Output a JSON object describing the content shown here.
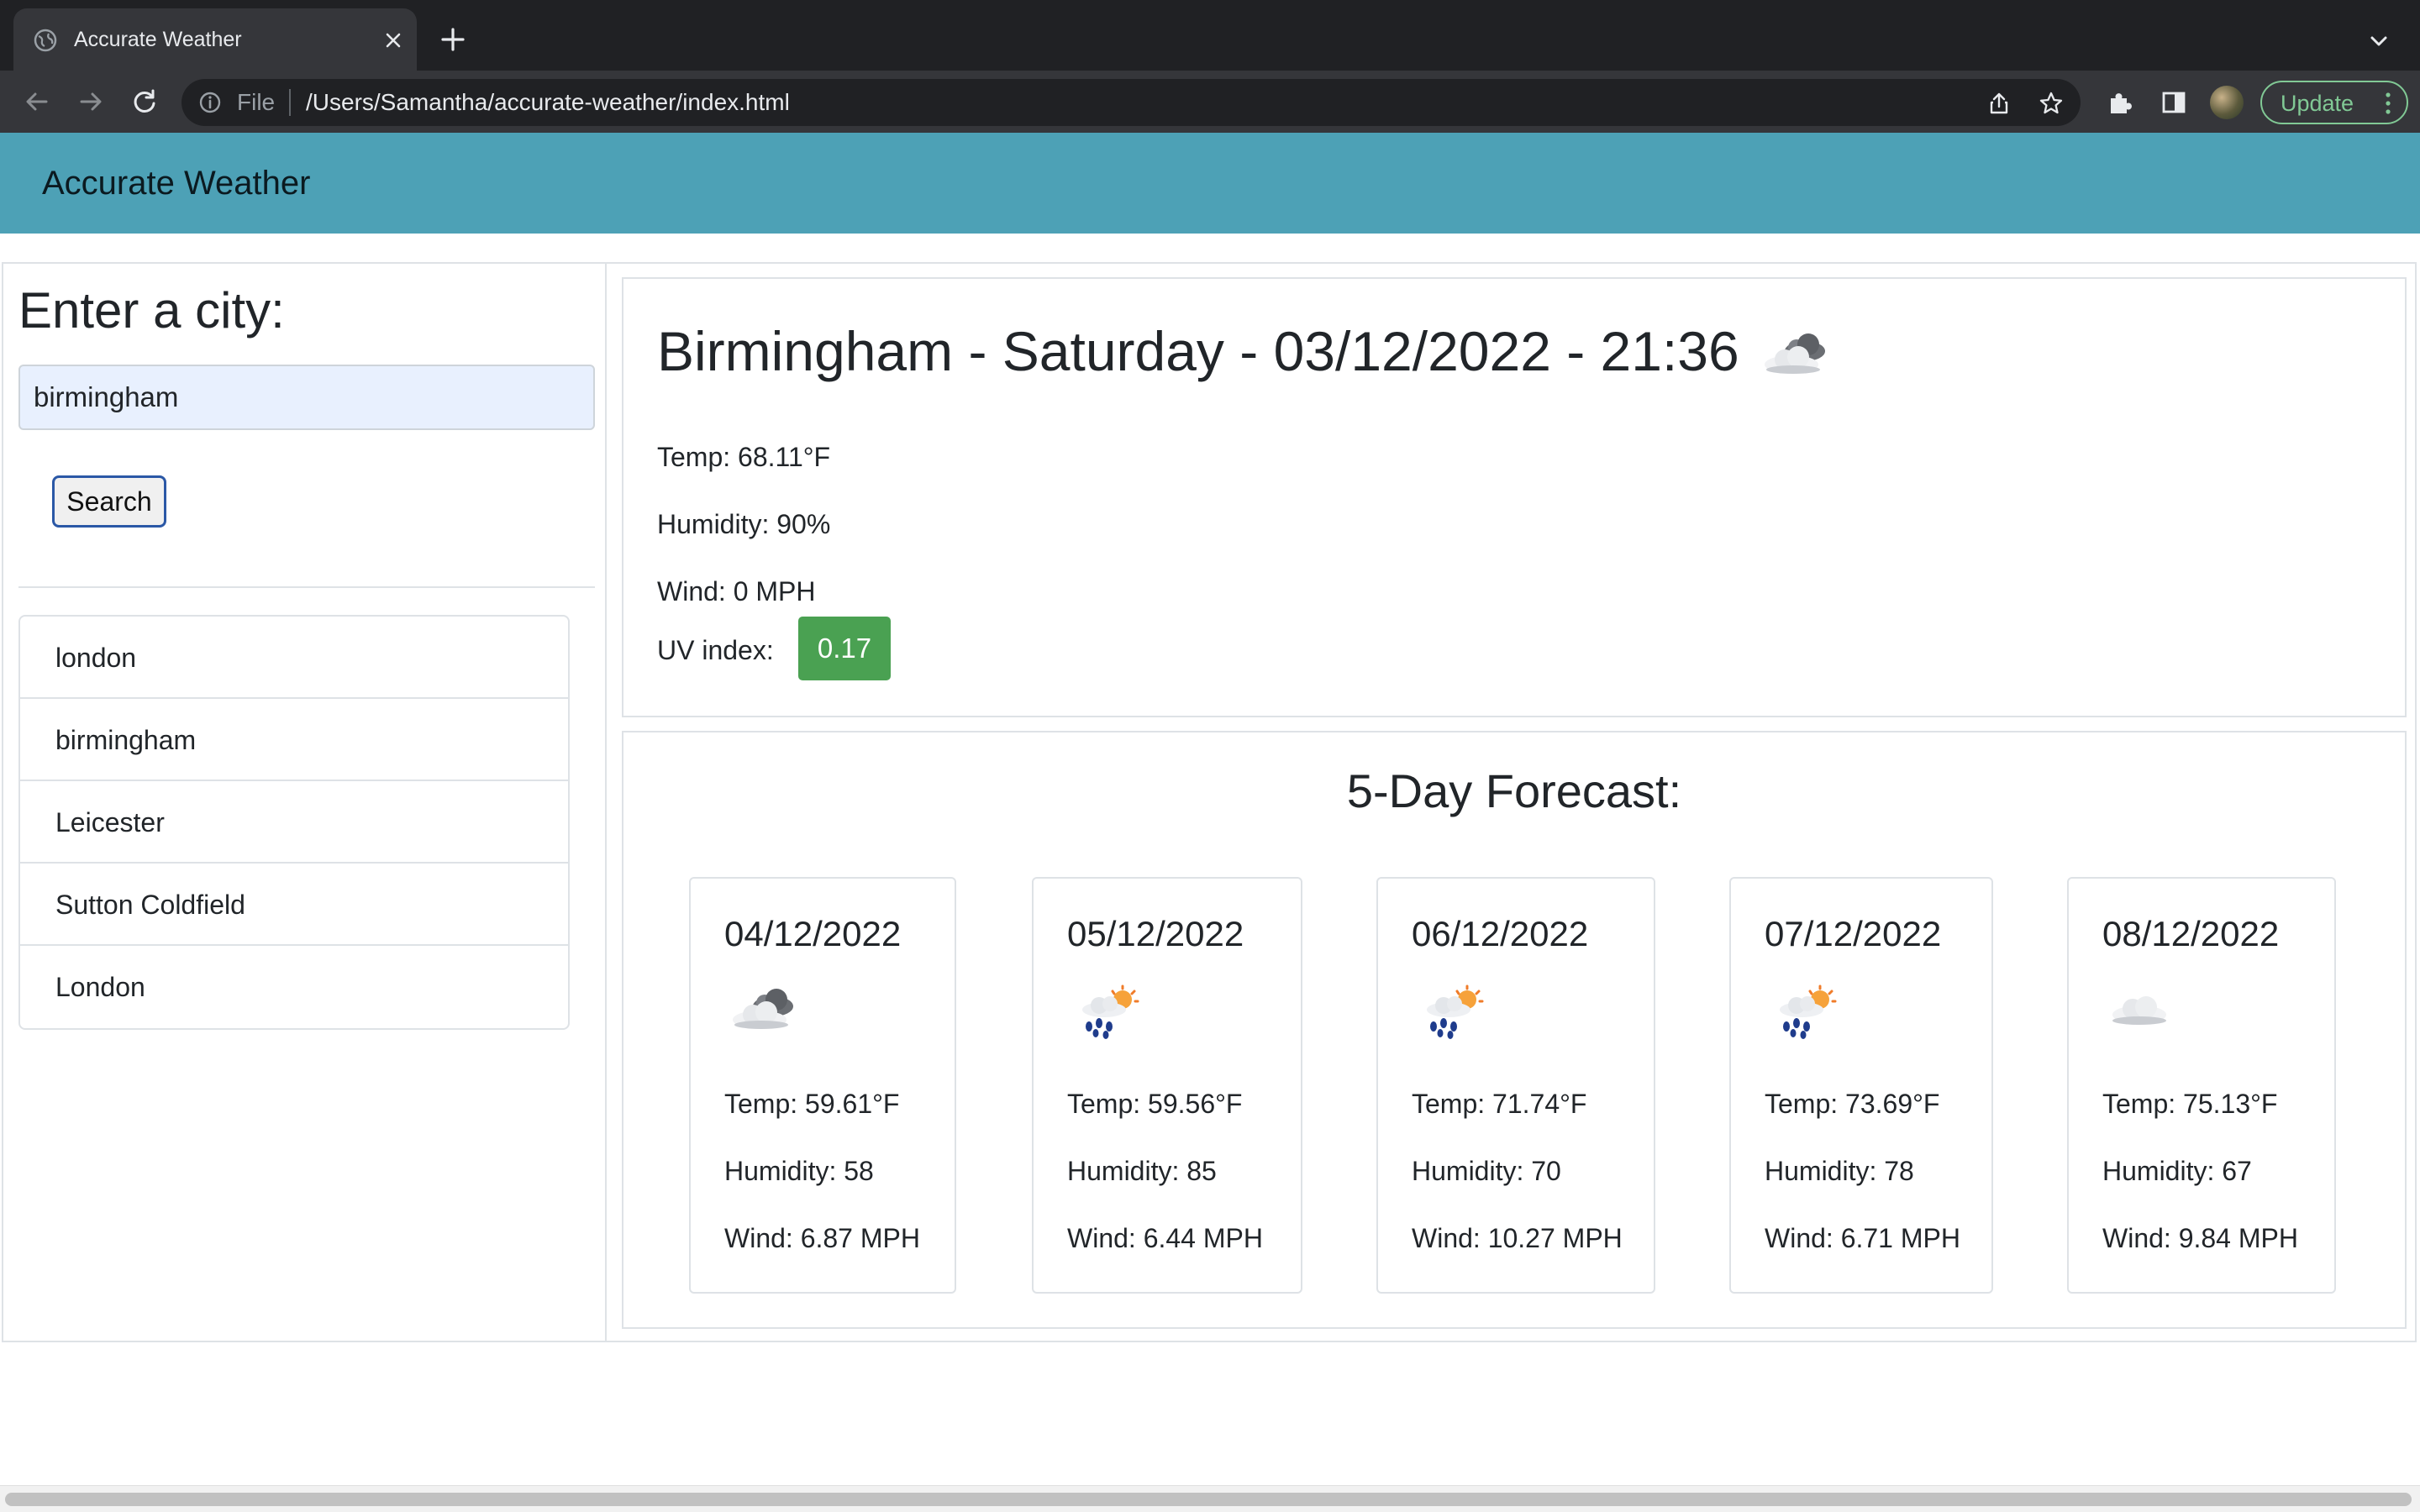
{
  "browser": {
    "tab_title": "Accurate Weather",
    "scheme": "File",
    "url": "/Users/Samantha/accurate-weather/index.html",
    "update_label": "Update"
  },
  "navbar": {
    "brand": "Accurate Weather"
  },
  "sidebar": {
    "title": "Enter a city:",
    "input_value": "birmingham",
    "search_label": "Search",
    "history": [
      "london",
      "birmingham",
      "Leicester",
      "Sutton Coldfield",
      "London"
    ]
  },
  "current": {
    "title": "Birmingham - Saturday - 03/12/2022 - 21:36",
    "icon": "broken-clouds-icon",
    "temp": "Temp: 68.11°F",
    "humidity": "Humidity: 90%",
    "wind": "Wind: 0 MPH",
    "uv_label": "UV index:",
    "uv_value": "0.17",
    "uv_color": "#4aa152"
  },
  "forecast": {
    "title": "5-Day Forecast:",
    "days": [
      {
        "date": "04/12/2022",
        "icon": "broken-clouds-icon",
        "temp": "Temp: 59.61°F",
        "humidity": "Humidity: 58",
        "wind": "Wind: 6.87 MPH"
      },
      {
        "date": "05/12/2022",
        "icon": "rain-sun-icon",
        "temp": "Temp: 59.56°F",
        "humidity": "Humidity: 85",
        "wind": "Wind: 6.44 MPH"
      },
      {
        "date": "06/12/2022",
        "icon": "rain-sun-icon",
        "temp": "Temp: 71.74°F",
        "humidity": "Humidity: 70",
        "wind": "Wind: 10.27 MPH"
      },
      {
        "date": "07/12/2022",
        "icon": "rain-sun-icon",
        "temp": "Temp: 73.69°F",
        "humidity": "Humidity: 78",
        "wind": "Wind: 6.71 MPH"
      },
      {
        "date": "08/12/2022",
        "icon": "cloud-icon",
        "temp": "Temp: 75.13°F",
        "humidity": "Humidity: 67",
        "wind": "Wind: 9.84 MPH"
      }
    ]
  },
  "colors": {
    "navbar": "#4da1b6",
    "uv_badge": "#4aa152",
    "search_border": "#2b58a6"
  }
}
